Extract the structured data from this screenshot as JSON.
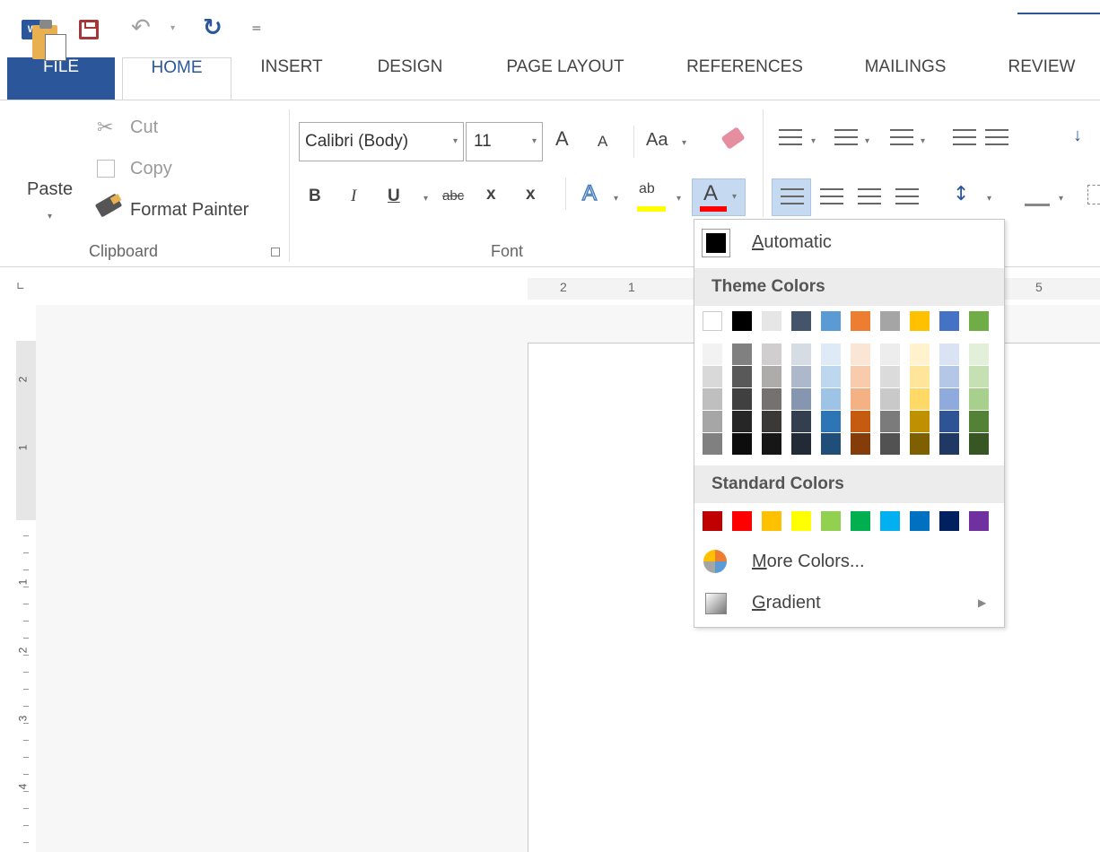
{
  "qat": {
    "app_icon_text": "W",
    "undo_caret": "▾",
    "more_label": "="
  },
  "tabs": [
    "FILE",
    "HOME",
    "INSERT",
    "DESIGN",
    "PAGE LAYOUT",
    "REFERENCES",
    "MAILINGS",
    "REVIEW"
  ],
  "clipboard": {
    "paste_label": "Paste",
    "cut_label": "Cut",
    "copy_label": "Copy",
    "format_painter_label": "Format Painter",
    "group_label": "Clipboard"
  },
  "font": {
    "font_name": "Calibri (Body)",
    "font_size": "11",
    "grow_label": "A",
    "shrink_label": "A",
    "case_label": "Aa",
    "bold_label": "B",
    "italic_label": "I",
    "underline_label": "U",
    "strike_label": "abc",
    "subscript_label": "x",
    "superscript_label": "x",
    "effects_label": "A",
    "highlight_label": "ab",
    "font_color_label": "A",
    "group_label": "Font"
  },
  "ruler": {
    "h_labels": [
      "2",
      "1",
      "5"
    ],
    "v_labels": [
      "2",
      "1",
      "1",
      "2",
      "3",
      "4"
    ]
  },
  "color_menu": {
    "automatic_label": "Automatic",
    "theme_header": "Theme Colors",
    "standard_header": "Standard Colors",
    "more_colors_label": "More Colors...",
    "gradient_label": "Gradient",
    "theme_base": [
      "#ffffff",
      "#000000",
      "#e7e6e6",
      "#44546a",
      "#5b9bd5",
      "#ed7d31",
      "#a5a5a5",
      "#ffc000",
      "#4472c4",
      "#70ad47"
    ],
    "theme_shades": [
      [
        "#f2f2f2",
        "#d9d9d9",
        "#bfbfbf",
        "#a6a6a6",
        "#808080"
      ],
      [
        "#808080",
        "#595959",
        "#404040",
        "#262626",
        "#0d0d0d"
      ],
      [
        "#d0cece",
        "#aeabab",
        "#767171",
        "#3b3838",
        "#171616"
      ],
      [
        "#d6dce4",
        "#adb9ca",
        "#8496b0",
        "#333f4f",
        "#222a35"
      ],
      [
        "#deebf6",
        "#bdd7ee",
        "#9dc3e6",
        "#2e75b5",
        "#1f4e79"
      ],
      [
        "#fbe5d5",
        "#f7cbac",
        "#f4b183",
        "#c55a11",
        "#843c0b"
      ],
      [
        "#ededed",
        "#dbdbdb",
        "#c9c9c9",
        "#7b7b7b",
        "#525252"
      ],
      [
        "#fff2cc",
        "#fee599",
        "#ffd965",
        "#bf9000",
        "#7f6000"
      ],
      [
        "#dae3f3",
        "#b4c7e7",
        "#8faadc",
        "#2f5496",
        "#1f3864"
      ],
      [
        "#e2efd9",
        "#c5e0b3",
        "#a8d08d",
        "#538135",
        "#375623"
      ]
    ],
    "standard": [
      "#c00000",
      "#ff0000",
      "#ffc000",
      "#ffff00",
      "#92d050",
      "#00b050",
      "#00b0f0",
      "#0070c0",
      "#002060",
      "#7030a0"
    ]
  }
}
